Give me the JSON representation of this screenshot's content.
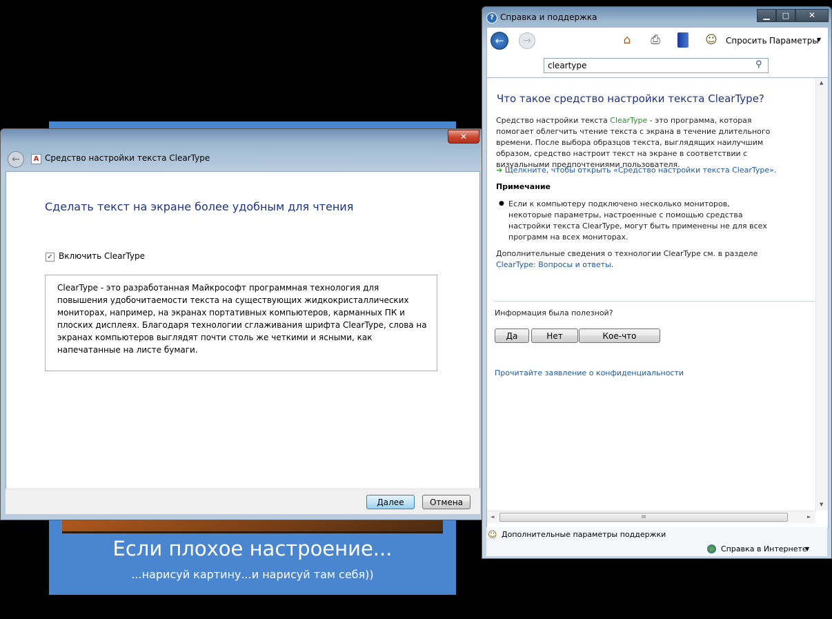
{
  "background": {
    "caption": "Если плохое настроение...",
    "subcaption": "...нарисуй картину...и нарисуй там себя))"
  },
  "cleartype_window": {
    "title": "Средство настройки текста ClearType",
    "close_glyph": "✕",
    "back_glyph": "←",
    "app_icon_letter": "A",
    "heading": "Сделать текст на экране более удобным для чтения",
    "checkbox_label": "Включить ClearType",
    "checkbox_checked": true,
    "description": "ClearType - это разработанная Майкрософт программная технология для повышения удобочитаемости текста на существующих жидкокристаллических мониторах, например, на экранах портативных компьютеров, карманных ПК и плоских дисплеях. Благодаря технологии сглаживания шрифта ClearType, слова на экранах компьютеров выглядят почти столь же четкими и ясными, как напечатанные на листе бумаги.",
    "next_button": "Далее",
    "cancel_button": "Отмена"
  },
  "help_window": {
    "title": "Справка и поддержка",
    "controls": {
      "minimize": "▁",
      "maximize": "□",
      "close": "✕"
    },
    "toolbar": {
      "back_glyph": "←",
      "forward_glyph": "→",
      "ask_label": "Спросить",
      "params_label": "Параметры",
      "dropdown_glyph": "▼"
    },
    "search": {
      "value": "cleartype"
    },
    "article": {
      "heading": "Что такое средство настройки текста ClearType?",
      "p1_before": "Средство настройки текста ",
      "p1_highlight": "ClearType",
      "p1_after": " - это программа, которая помогает облегчить чтение текста с экрана в течение длительного времени. После выбора образцов текста, выглядящих наилучшим образом, средство настроит текст на экране в соответствии с визуальными предпочтениями пользователя.",
      "open_link_arrow": "➔",
      "open_link": "Щелкните, чтобы открыть «Средство настройки текста ClearType».",
      "note_heading": "Примечание",
      "bullet": "●",
      "note_text": "Если к компьютеру подключено несколько мониторов, некоторые параметры, настроенные с помощью средства настройки текста ClearType, могут быть применены не для всех программ на всех мониторах.",
      "more_before": "Дополнительные сведения о технологии ClearType см. в разделе ",
      "more_link": "ClearType: Вопросы и ответы",
      "more_after": "."
    },
    "feedback": {
      "question": "Информация была полезной?",
      "yes": "Да",
      "no": "Нет",
      "somewhat": "Кое-что"
    },
    "privacy_link": "Прочитайте заявление о конфиденциальности",
    "scrollbar": {
      "up": "▲",
      "down": "▼",
      "left": "◄",
      "right": "►",
      "grip": "III"
    },
    "statusbar": {
      "support_label": "Дополнительные параметры поддержки",
      "online_label": "Справка в Интернете",
      "dropdown_glyph": "▼"
    }
  }
}
